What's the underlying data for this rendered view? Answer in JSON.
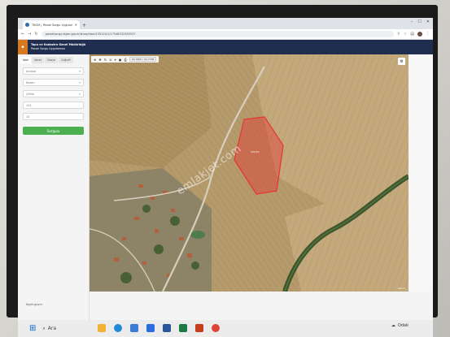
{
  "browser": {
    "tab_title": "TKGM | Parsel Sorgu Uygulama...",
    "url": "parselsorgu.tkgm.gov.tr/#ara/idari/135120/1/17548332355537",
    "new_tab_symbol": "+"
  },
  "app": {
    "header_line1": "Tapu ve Kadastro Genel Müdürlüğü",
    "header_line2": "Parsel Sorgu Uygulaması"
  },
  "sidebar": {
    "tabs": [
      "İdari",
      "Adres",
      "Dosya",
      "Coğrafi"
    ],
    "fields": [
      {
        "value": "Ankara",
        "has_dropdown": true
      },
      {
        "value": "Kazan",
        "has_dropdown": true
      },
      {
        "value": "Çiftlik",
        "has_dropdown": true
      },
      {
        "value": "101",
        "has_dropdown": false
      },
      {
        "value": "10",
        "has_dropdown": false
      }
    ],
    "query_button": "Sorgula",
    "footer_link": "tkgm.gov.tr"
  },
  "map": {
    "toolbar_icons": [
      "⊕",
      "✥",
      "↻",
      "⊘",
      "⌖",
      "▣",
      "⎙"
    ],
    "coord_text": "29.7905 / 32.7766",
    "parcel_label": "101/10",
    "watermark": "emlakjet.com",
    "scale_text": "100 m",
    "parcel_color": "#e53935"
  },
  "taskbar": {
    "search_label": "Ara",
    "weather_label": "Odak",
    "start_color": "#0a64c8",
    "apps": [
      {
        "icon": "file-explorer-icon",
        "color": "#f2b233"
      },
      {
        "icon": "edge-icon",
        "color": "#1f8ad6"
      },
      {
        "icon": "store-icon",
        "color": "#3a7bd5"
      },
      {
        "icon": "mail-icon",
        "color": "#2d6cdf"
      },
      {
        "icon": "word-icon",
        "color": "#2b579a"
      },
      {
        "icon": "excel-icon",
        "color": "#1d7a45"
      },
      {
        "icon": "powerpoint-icon",
        "color": "#c43e1c"
      },
      {
        "icon": "chrome-icon",
        "color": "#db4437"
      }
    ]
  }
}
